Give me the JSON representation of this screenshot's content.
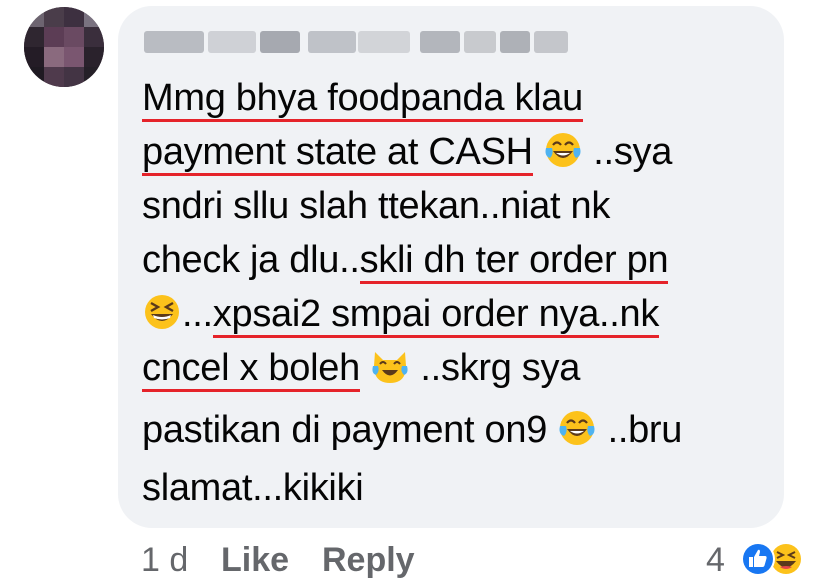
{
  "comment": {
    "author": "",
    "lines": {
      "l1": "Mmg bhya foodpanda klau",
      "l2a": "payment state at CASH",
      "l2b": " ..sya",
      "l3": "sndri sllu slah ttekan..niat nk",
      "l4a": "check ja dlu..",
      "l4b": "skli dh ter order pn",
      "l5a": "...",
      "l5b": "xpsai2 smpai order nya..nk",
      "l6a": "cncel x boleh",
      "l6b": " ..skrg sya",
      "l7a": "pastikan di payment on9",
      "l7b": " ..bru",
      "l8": "slamat...kikiki"
    },
    "emojis": [
      "face-with-tears-of-joy",
      "grinning-squinting-face",
      "cat-with-tears-of-joy",
      "face-with-tears-of-joy"
    ]
  },
  "actions": {
    "time": "1 d",
    "like": "Like",
    "reply": "Reply"
  },
  "reactions": {
    "count": "4",
    "icons": [
      "like-reaction-icon",
      "haha-reaction-icon"
    ]
  },
  "colors": {
    "bubble": "#f0f2f5",
    "text": "#050505",
    "meta": "#65676b",
    "underline": "#e5232a",
    "like_blue": "#1877f2",
    "emoji_yellow": "#fcc21b"
  }
}
